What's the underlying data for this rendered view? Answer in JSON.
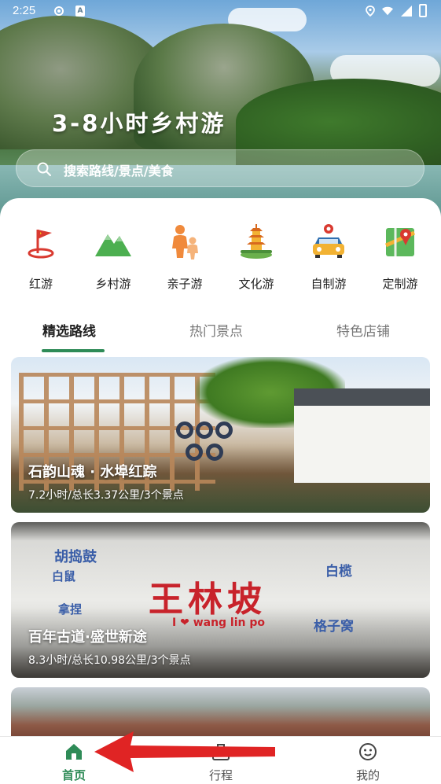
{
  "status_bar": {
    "time": "2:25"
  },
  "hero": {
    "title": "3-8小时乡村游"
  },
  "search": {
    "placeholder": "搜索路线/景点/美食"
  },
  "categories": [
    {
      "label": "红游",
      "icon": "red-flag-icon"
    },
    {
      "label": "乡村游",
      "icon": "mountain-icon"
    },
    {
      "label": "亲子游",
      "icon": "family-icon"
    },
    {
      "label": "文化游",
      "icon": "pagoda-icon"
    },
    {
      "label": "自制游",
      "icon": "car-icon"
    },
    {
      "label": "定制游",
      "icon": "map-icon"
    }
  ],
  "tabs": [
    {
      "label": "精选路线",
      "active": true
    },
    {
      "label": "热门景点",
      "active": false
    },
    {
      "label": "特色店铺",
      "active": false
    }
  ],
  "cards": [
    {
      "title": "石韵山魂 · 水埠红踪",
      "subtitle": "7.2小时/总长3.37公里/3个景点"
    },
    {
      "title": "百年古道·盛世新途",
      "subtitle": "8.3小时/总长10.98公里/3个景点"
    },
    {
      "title": "",
      "subtitle": ""
    }
  ],
  "card2_signage": {
    "big": "王林坡",
    "love": "I ❤ wang lin po"
  },
  "bottom_nav": [
    {
      "label": "首页",
      "icon": "home-icon",
      "active": true
    },
    {
      "label": "行程",
      "icon": "briefcase-icon",
      "active": false
    },
    {
      "label": "我的",
      "icon": "smiley-icon",
      "active": false
    }
  ],
  "colors": {
    "accent": "#2e8b57",
    "annotation_arrow": "#e02424"
  }
}
